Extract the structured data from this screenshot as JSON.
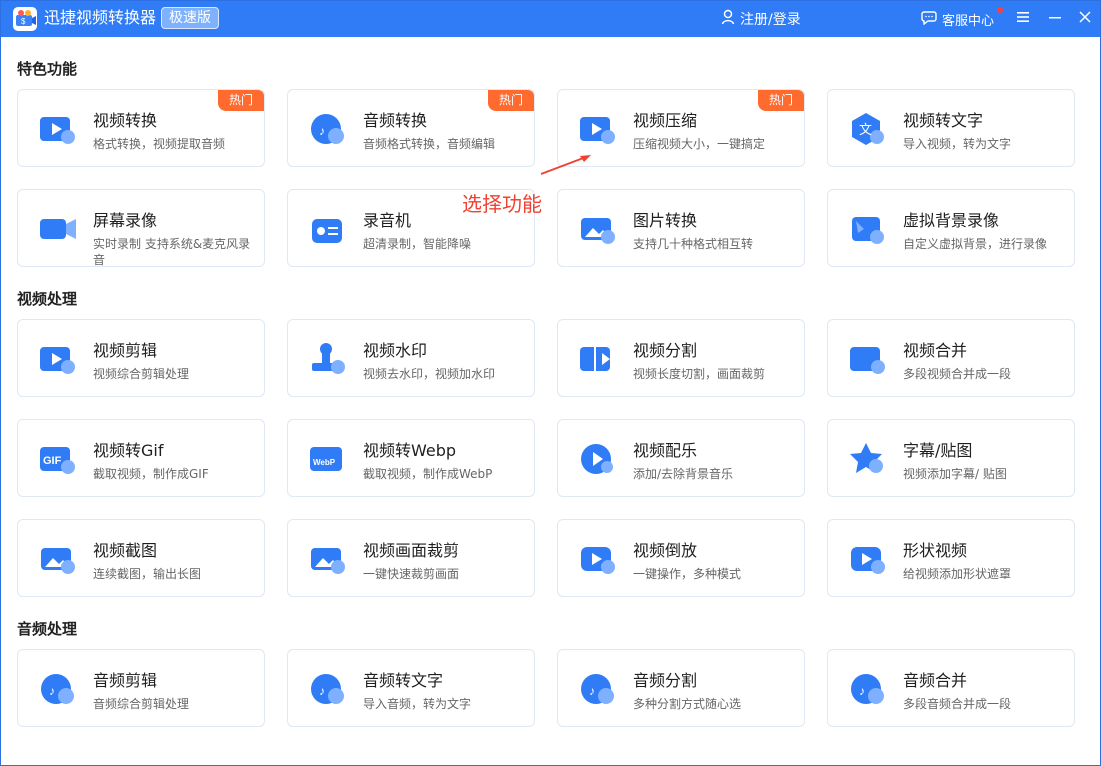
{
  "app": {
    "title": "迅捷视频转换器",
    "edition_badge": "极速版",
    "login_text": "注册/登录",
    "support_text": "客服中心"
  },
  "annotation": "选择功能",
  "sections": [
    {
      "title": "特色功能",
      "items": [
        {
          "title": "视频转换",
          "desc": "格式转换，视频提取音频",
          "badge": "热门",
          "icon": "video-convert-icon"
        },
        {
          "title": "音频转换",
          "desc": "音频格式转换，音频编辑",
          "badge": "热门",
          "icon": "audio-convert-icon"
        },
        {
          "title": "视频压缩",
          "desc": "压缩视频大小，一键搞定",
          "badge": "热门",
          "icon": "video-compress-icon"
        },
        {
          "title": "视频转文字",
          "desc": "导入视频，转为文字",
          "badge": "",
          "icon": "video-to-text-icon"
        },
        {
          "title": "屏幕录像",
          "desc": "实时录制 支持系统&麦克风录音",
          "badge": "",
          "icon": "screen-record-icon"
        },
        {
          "title": "录音机",
          "desc": "超清录制，智能降噪",
          "badge": "",
          "icon": "recorder-icon"
        },
        {
          "title": "图片转换",
          "desc": "支持几十种格式相互转",
          "badge": "",
          "icon": "image-convert-icon"
        },
        {
          "title": "虚拟背景录像",
          "desc": "自定义虚拟背景，进行录像",
          "badge": "",
          "icon": "virtual-background-icon"
        }
      ]
    },
    {
      "title": "视频处理",
      "items": [
        {
          "title": "视频剪辑",
          "desc": "视频综合剪辑处理",
          "badge": "",
          "icon": "video-edit-icon"
        },
        {
          "title": "视频水印",
          "desc": "视频去水印，视频加水印",
          "badge": "",
          "icon": "video-watermark-icon"
        },
        {
          "title": "视频分割",
          "desc": "视频长度切割，画面裁剪",
          "badge": "",
          "icon": "video-split-icon"
        },
        {
          "title": "视频合并",
          "desc": "多段视频合并成一段",
          "badge": "",
          "icon": "video-merge-icon"
        },
        {
          "title": "视频转Gif",
          "desc": "截取视频，制作成GIF",
          "badge": "",
          "icon": "video-gif-icon"
        },
        {
          "title": "视频转Webp",
          "desc": "截取视频，制作成WebP",
          "badge": "",
          "icon": "video-webp-icon"
        },
        {
          "title": "视频配乐",
          "desc": "添加/去除背景音乐",
          "badge": "",
          "icon": "video-music-icon"
        },
        {
          "title": "字幕/贴图",
          "desc": "视频添加字幕/ 贴图",
          "badge": "",
          "icon": "subtitle-sticker-icon"
        },
        {
          "title": "视频截图",
          "desc": "连续截图，输出长图",
          "badge": "",
          "icon": "video-screenshot-icon"
        },
        {
          "title": "视频画面裁剪",
          "desc": "一键快速裁剪画面",
          "badge": "",
          "icon": "video-crop-icon"
        },
        {
          "title": "视频倒放",
          "desc": "一键操作，多种模式",
          "badge": "",
          "icon": "video-reverse-icon"
        },
        {
          "title": "形状视频",
          "desc": "给视频添加形状遮罩",
          "badge": "",
          "icon": "shape-video-icon"
        }
      ]
    },
    {
      "title": "音频处理",
      "items": [
        {
          "title": "音频剪辑",
          "desc": "音频综合剪辑处理",
          "badge": "",
          "icon": "audio-edit-icon"
        },
        {
          "title": "音频转文字",
          "desc": "导入音频，转为文字",
          "badge": "",
          "icon": "audio-to-text-icon"
        },
        {
          "title": "音频分割",
          "desc": "多种分割方式随心选",
          "badge": "",
          "icon": "audio-split-icon"
        },
        {
          "title": "音频合并",
          "desc": "多段音频合并成一段",
          "badge": "",
          "icon": "audio-merge-icon"
        }
      ]
    }
  ],
  "colors": {
    "brand_blue": "#2f7cf6",
    "hot_orange": "#ff6a2e",
    "annotation_red": "#ef4232"
  }
}
